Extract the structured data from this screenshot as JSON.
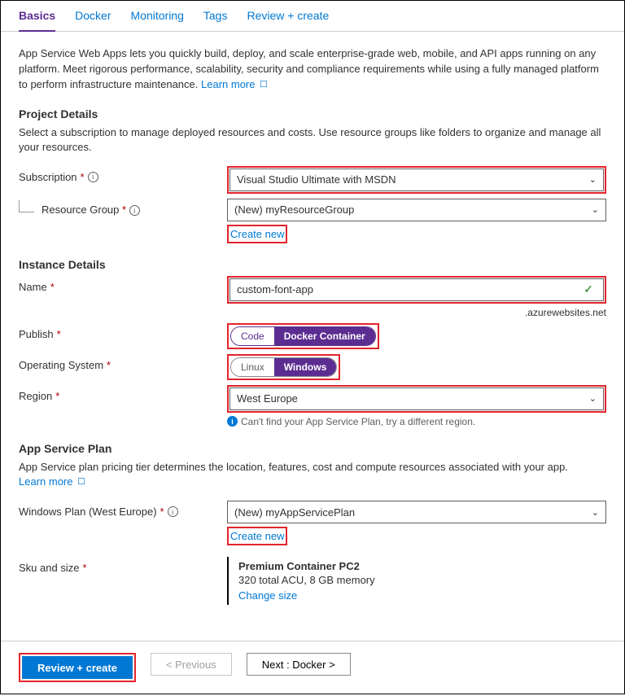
{
  "tabs": [
    "Basics",
    "Docker",
    "Monitoring",
    "Tags",
    "Review + create"
  ],
  "intro_text": "App Service Web Apps lets you quickly build, deploy, and scale enterprise-grade web, mobile, and API apps running on any platform. Meet rigorous performance, scalability, security and compliance requirements while using a fully managed platform to perform infrastructure maintenance.   ",
  "learn_more": "Learn more",
  "sections": {
    "project": {
      "title": "Project Details",
      "desc": "Select a subscription to manage deployed resources and costs. Use resource groups like folders to organize and manage all your resources.",
      "subscription_label": "Subscription",
      "subscription_value": "Visual Studio Ultimate with MSDN",
      "rg_label": "Resource Group",
      "rg_value": "(New) myResourceGroup",
      "create_new": "Create new"
    },
    "instance": {
      "title": "Instance Details",
      "name_label": "Name",
      "name_value": "custom-font-app",
      "name_suffix": ".azurewebsites.net",
      "publish_label": "Publish",
      "publish_code": "Code",
      "publish_docker": "Docker Container",
      "os_label": "Operating System",
      "os_linux": "Linux",
      "os_windows": "Windows",
      "region_label": "Region",
      "region_value": "West Europe",
      "region_hint": "Can't find your App Service Plan, try a different region."
    },
    "plan": {
      "title": "App Service Plan",
      "desc": "App Service plan pricing tier determines the location, features, cost and compute resources associated with your app.",
      "plan_label": "Windows Plan (West Europe)",
      "plan_value": "(New) myAppServicePlan",
      "create_new": "Create new",
      "sku_label": "Sku and size",
      "sku_title": "Premium Container PC2",
      "sku_sub": "320 total ACU, 8 GB memory",
      "change_size": "Change size"
    }
  },
  "footer": {
    "review": "Review + create",
    "previous": "< Previous",
    "next": "Next : Docker >"
  }
}
